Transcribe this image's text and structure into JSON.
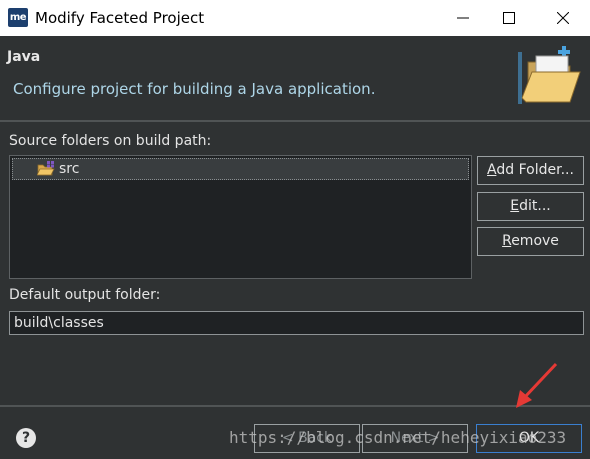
{
  "window": {
    "logo": "me",
    "title": "Modify Faceted Project"
  },
  "header": {
    "title": "Java",
    "description": "Configure project for building a Java application."
  },
  "source": {
    "label": "Source folders on build path:",
    "items": [
      {
        "label": "src"
      }
    ]
  },
  "buttons": {
    "add_folder": {
      "mnemonic": "A",
      "rest": "dd Folder..."
    },
    "edit": {
      "mnemonic": "E",
      "rest": "dit..."
    },
    "remove": {
      "mnemonic": "R",
      "rest": "emove"
    }
  },
  "output": {
    "label": "Default output folder:",
    "value": "build\\classes"
  },
  "footer": {
    "help": "?",
    "back": "< Back",
    "next": "Next >",
    "ok": "OK",
    "watermark": "https://blog.csdn.net/heheyixiao233"
  },
  "colors": {
    "background": "#2f3233",
    "accent_arrow": "#e53935",
    "description_text": "#aed6e8"
  },
  "icons": {
    "header": "folder-open-icon",
    "tree_item": "package-folder-icon"
  }
}
